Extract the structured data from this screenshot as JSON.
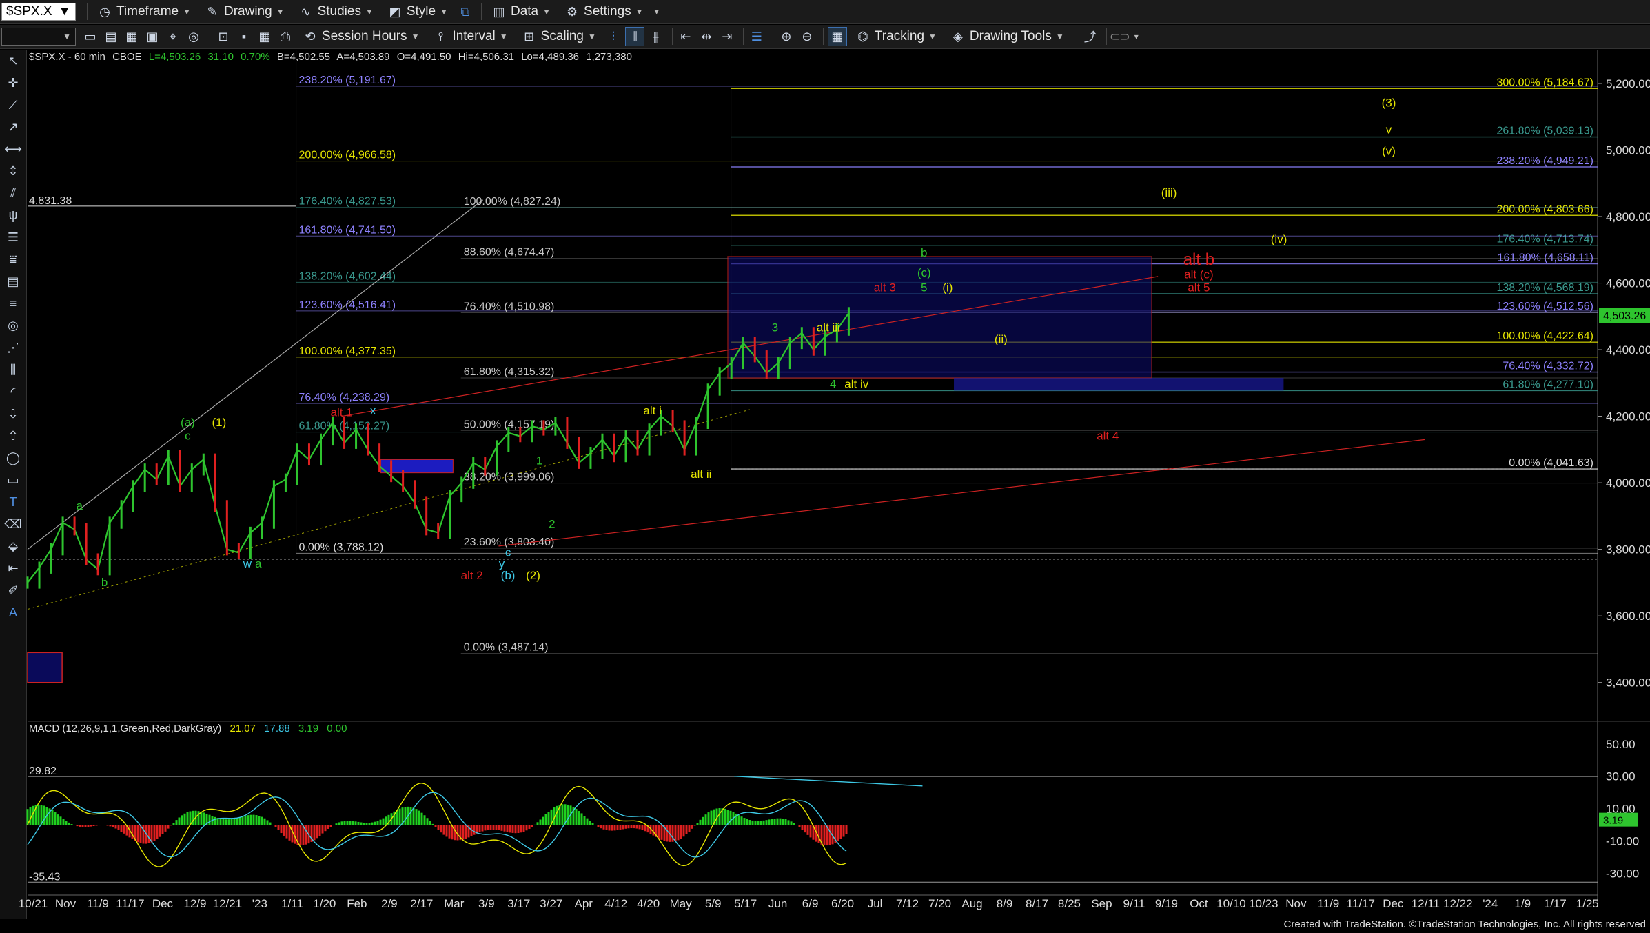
{
  "toolbar1": {
    "symbol": "$SPX.X",
    "items": [
      "Timeframe",
      "Drawing",
      "Studies",
      "Style",
      "Data",
      "Settings"
    ]
  },
  "toolbar2": {
    "items": [
      "Session Hours",
      "Interval",
      "Scaling",
      "Tracking",
      "Drawing Tools"
    ]
  },
  "header": {
    "symbol_line": "$SPX.X - 60 min",
    "exchange": "CBOE",
    "last": "L=4,503.26",
    "change": "31.10",
    "pct": "0.70%",
    "bid": "B=4,502.55",
    "ask": "A=4,503.89",
    "open": "O=4,491.50",
    "high": "Hi=4,506.31",
    "low": "Lo=4,489.36",
    "volume": "1,273,380"
  },
  "macd_header": {
    "label": "MACD (12,26,9,1,1,Green,Red,DarkGray)",
    "v1": "21.07",
    "v2": "17.88",
    "v3": "3.19",
    "v4": "0.00"
  },
  "footer": "Created with TradeStation. ©TradeStation Technologies, Inc. All rights reserved",
  "chart_data": {
    "type": "line",
    "title": "",
    "price_axis": [
      "5,200.00",
      "5,000.00",
      "4,800.00",
      "4,600.00",
      "4,400.00",
      "4,200.00",
      "4,000.00",
      "3,800.00",
      "3,600.00",
      "3,400.00"
    ],
    "price_values": [
      5200,
      5000,
      4800,
      4600,
      4400,
      4200,
      4000,
      3800,
      3600,
      3400
    ],
    "ylim": [
      3300,
      5260
    ],
    "last_price": "4,503.26",
    "macd_axis": [
      "50.00",
      "30.00",
      "10.00",
      "-10.00",
      "-30.00"
    ],
    "macd_values": [
      50,
      30,
      10,
      -10,
      -30
    ],
    "macd_last": "3.19",
    "macd_lines": [
      "29.82",
      "-35.43"
    ],
    "time_axis": [
      "10/21",
      "Nov",
      "11/9",
      "11/17",
      "Dec",
      "12/9",
      "12/21",
      "'23",
      "1/11",
      "1/20",
      "Feb",
      "2/9",
      "2/17",
      "Mar",
      "3/9",
      "3/17",
      "3/27",
      "Apr",
      "4/12",
      "4/20",
      "May",
      "5/9",
      "5/17",
      "Jun",
      "6/9",
      "6/20",
      "Jul",
      "7/12",
      "7/20",
      "Aug",
      "8/9",
      "8/17",
      "8/25",
      "Sep",
      "9/11",
      "9/19",
      "Oct",
      "10/10",
      "10/23",
      "Nov",
      "11/9",
      "11/17",
      "Dec",
      "12/11",
      "12/22",
      "'24",
      "1/9",
      "1/17",
      "1/25"
    ],
    "left_level": "4,831.38",
    "price_series": [
      3700,
      3745,
      3800,
      3880,
      3860,
      3770,
      3740,
      3880,
      3930,
      3990,
      4040,
      4010,
      4080,
      3990,
      4040,
      4070,
      3930,
      3800,
      3790,
      3850,
      3880,
      3990,
      4010,
      4100,
      4070,
      4130,
      4180,
      4120,
      4160,
      4100,
      4050,
      4020,
      3990,
      3940,
      3860,
      3850,
      3960,
      4000,
      4060,
      4040,
      4110,
      4150,
      4140,
      4170,
      4160,
      4180,
      4120,
      4060,
      4090,
      4130,
      4080,
      4140,
      4100,
      4160,
      4200,
      4170,
      4100,
      4180,
      4280,
      4330,
      4360,
      4420,
      4380,
      4330,
      4360,
      4420,
      4450,
      4400,
      4440,
      4460,
      4510
    ],
    "fib_levels_right": [
      {
        "label": "300.00% (5,184.67)",
        "price": 5184.67,
        "color": "#e6e600"
      },
      {
        "label": "261.80% (5,039.13)",
        "price": 5039.13,
        "color": "#3a9a8f"
      },
      {
        "label": "238.20% (4,949.21)",
        "price": 4949.21,
        "color": "#8e82ff"
      },
      {
        "label": "200.00% (4,803.66)",
        "price": 4803.66,
        "color": "#e6e600"
      },
      {
        "label": "176.40% (4,713.74)",
        "price": 4713.74,
        "color": "#3a9a8f"
      },
      {
        "label": "161.80% (4,658.11)",
        "price": 4658.11,
        "color": "#8e82ff"
      },
      {
        "label": "138.20% (4,568.19)",
        "price": 4568.19,
        "color": "#3a9a8f"
      },
      {
        "label": "123.60% (4,512.56)",
        "price": 4512.56,
        "color": "#8e82ff"
      },
      {
        "label": "100.00% (4,422.64)",
        "price": 4422.64,
        "color": "#e6e600"
      },
      {
        "label": "76.40% (4,332.72)",
        "price": 4332.72,
        "color": "#8e82ff"
      },
      {
        "label": "61.80% (4,277.10)",
        "price": 4277.1,
        "color": "#3a9a8f"
      },
      {
        "label": "0.00% (4,041.63)",
        "price": 4041.63,
        "color": "#dddddd"
      }
    ],
    "fib_levels_left": [
      {
        "label": "238.20% (5,191.67)",
        "price": 5191.67,
        "color": "#8e82ff"
      },
      {
        "label": "200.00% (4,966.58)",
        "price": 4966.58,
        "color": "#e6e600"
      },
      {
        "label": "176.40% (4,827.53)",
        "price": 4827.53,
        "color": "#3a9a8f"
      },
      {
        "label": "161.80% (4,741.50)",
        "price": 4741.5,
        "color": "#8e82ff"
      },
      {
        "label": "138.20% (4,602.44)",
        "price": 4602.44,
        "color": "#3a9a8f"
      },
      {
        "label": "123.60% (4,516.41)",
        "price": 4516.41,
        "color": "#8e82ff"
      },
      {
        "label": "100.00% (4,377.35)",
        "price": 4377.35,
        "color": "#e6e600"
      },
      {
        "label": "76.40% (4,238.29)",
        "price": 4238.29,
        "color": "#8e82ff"
      },
      {
        "label": "61.80% (4,152.27)",
        "price": 4152.27,
        "color": "#3a9a8f"
      },
      {
        "label": "0.00% (3,788.12)",
        "price": 3788.12,
        "color": "#dddddd"
      }
    ],
    "fib_levels_mid": [
      {
        "label": "100.00% (4,827.24)",
        "price": 4827.24
      },
      {
        "label": "88.60% (4,674.47)",
        "price": 4674.47
      },
      {
        "label": "76.40% (4,510.98)",
        "price": 4510.98
      },
      {
        "label": "61.80% (4,315.32)",
        "price": 4315.32
      },
      {
        "label": "50.00% (4,157.19)",
        "price": 4157.19
      },
      {
        "label": "38.20% (3,999.06)",
        "price": 3999.06
      },
      {
        "label": "23.60% (3,803.40)",
        "price": 3803.4
      },
      {
        "label": "0.00% (3,487.14)",
        "price": 3487.14
      }
    ],
    "wave_labels": [
      {
        "text": "(3)",
        "color": "#e6e600",
        "price": 5130,
        "t": 0.867
      },
      {
        "text": "v",
        "color": "#e6e600",
        "price": 5050,
        "t": 0.867
      },
      {
        "text": "(v)",
        "color": "#e6e600",
        "price": 4985,
        "t": 0.867
      },
      {
        "text": "(iii)",
        "color": "#e6e600",
        "price": 4860,
        "t": 0.727
      },
      {
        "text": "(iv)",
        "color": "#e6e600",
        "price": 4720,
        "t": 0.797
      },
      {
        "text": "alt b",
        "color": "#e02020",
        "price": 4655,
        "t": 0.746
      },
      {
        "text": "alt (c)",
        "color": "#e02020",
        "price": 4615,
        "t": 0.746
      },
      {
        "text": "alt 5",
        "color": "#e02020",
        "price": 4575,
        "t": 0.746
      },
      {
        "text": "b",
        "color": "#2ec42e",
        "price": 4680,
        "t": 0.571
      },
      {
        "text": "(c)",
        "color": "#2ec42e",
        "price": 4620,
        "t": 0.571
      },
      {
        "text": "5",
        "color": "#2ec42e",
        "price": 4575,
        "t": 0.571
      },
      {
        "text": "(i)",
        "color": "#e6e600",
        "price": 4575,
        "t": 0.586
      },
      {
        "text": "alt 3",
        "color": "#e02020",
        "price": 4575,
        "t": 0.546
      },
      {
        "text": "(ii)",
        "color": "#e6e600",
        "price": 4420,
        "t": 0.62
      },
      {
        "text": "3",
        "color": "#2ec42e",
        "price": 4455,
        "t": 0.476
      },
      {
        "text": "alt iii",
        "color": "#e6e600",
        "price": 4455,
        "t": 0.51
      },
      {
        "text": "4",
        "color": "#2ec42e",
        "price": 4285,
        "t": 0.513
      },
      {
        "text": "alt iv",
        "color": "#e6e600",
        "price": 4285,
        "t": 0.528
      },
      {
        "text": "alt i",
        "color": "#e6e600",
        "price": 4205,
        "t": 0.398
      },
      {
        "text": "alt ii",
        "color": "#e6e600",
        "price": 4015,
        "t": 0.429
      },
      {
        "text": "alt 4",
        "color": "#e02020",
        "price": 4130,
        "t": 0.688
      },
      {
        "text": "alt 1",
        "color": "#e02020",
        "price": 4200,
        "t": 0.2
      },
      {
        "text": "x",
        "color": "#3ec9e6",
        "price": 4205,
        "t": 0.22
      },
      {
        "text": "1",
        "color": "#2ec42e",
        "price": 4055,
        "t": 0.326
      },
      {
        "text": "2",
        "color": "#2ec42e",
        "price": 3865,
        "t": 0.334
      },
      {
        "text": "(a)",
        "color": "#2ec42e",
        "price": 4170,
        "t": 0.102
      },
      {
        "text": "c",
        "color": "#2ec42e",
        "price": 4130,
        "t": 0.102
      },
      {
        "text": "(1)",
        "color": "#e6e600",
        "price": 4170,
        "t": 0.122
      },
      {
        "text": "a",
        "color": "#2ec42e",
        "price": 3920,
        "t": 0.033
      },
      {
        "text": "b",
        "color": "#2ec42e",
        "price": 3690,
        "t": 0.049
      },
      {
        "text": "w",
        "color": "#3ec9e6",
        "price": 3745,
        "t": 0.14
      },
      {
        "text": "a",
        "color": "#2ec42e",
        "price": 3745,
        "t": 0.147
      },
      {
        "text": "c",
        "color": "#3ec9e6",
        "price": 3780,
        "t": 0.306
      },
      {
        "text": "y",
        "color": "#3ec9e6",
        "price": 3745,
        "t": 0.302
      },
      {
        "text": "(b)",
        "color": "#3ec9e6",
        "price": 3710,
        "t": 0.306
      },
      {
        "text": "(2)",
        "color": "#e6e600",
        "price": 3710,
        "t": 0.322
      },
      {
        "text": "alt 2",
        "color": "#e02020",
        "price": 3710,
        "t": 0.283
      }
    ]
  }
}
